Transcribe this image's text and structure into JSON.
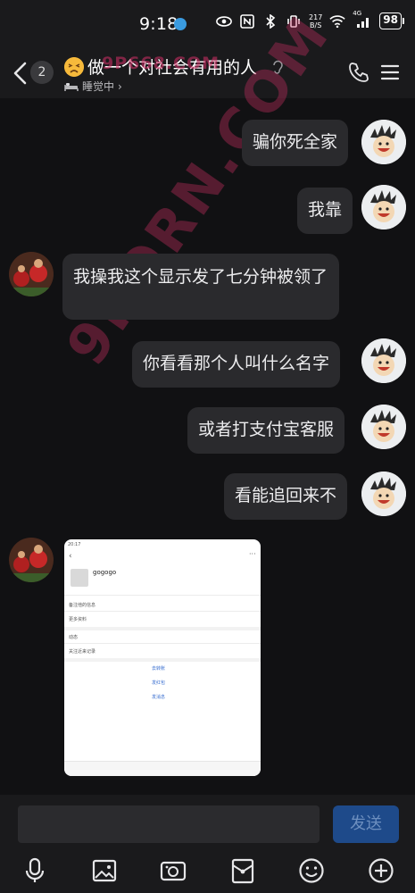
{
  "status_bar": {
    "time": "9:18",
    "net_speed_value": "217",
    "net_speed_unit": "B/S",
    "network_type": "4G",
    "battery": "98"
  },
  "header": {
    "unread_count": "2",
    "title": "做一个对社会有用的人",
    "status_text": "睡觉中",
    "status_chevron": "›"
  },
  "watermark": {
    "top": "9P668.COM",
    "diagonal": "9PORN.COM"
  },
  "messages": [
    {
      "side": "right",
      "text": "骗你死全家"
    },
    {
      "side": "right",
      "text": "我靠"
    },
    {
      "side": "left",
      "text": "我操我这个显示发了七分钟被领了"
    },
    {
      "side": "right",
      "text": "你看看那个人叫什么名字"
    },
    {
      "side": "right",
      "text": "或者打支付宝客服"
    },
    {
      "side": "right",
      "text": "看能追回来不"
    },
    {
      "side": "left",
      "type": "image",
      "alt": "screenshot"
    }
  ],
  "image_msg": {
    "status_time": "20:17",
    "name": "gogogo",
    "row1": "备注他的信息",
    "row2": "更多资料",
    "row3": "动态",
    "row4": "关注近来记录",
    "action1": "去转账",
    "action2": "发红包",
    "action3": "发消息"
  },
  "input": {
    "placeholder": "",
    "send_label": "发送"
  },
  "toolbar": {
    "icons": [
      "microphone-icon",
      "image-icon",
      "camera-icon",
      "red-packet-icon",
      "emoji-icon",
      "plus-icon"
    ]
  },
  "colors": {
    "background": "#111113",
    "bubble": "#2a2a2d",
    "send_button": "#1e4a8a",
    "watermark": "#d63068"
  }
}
